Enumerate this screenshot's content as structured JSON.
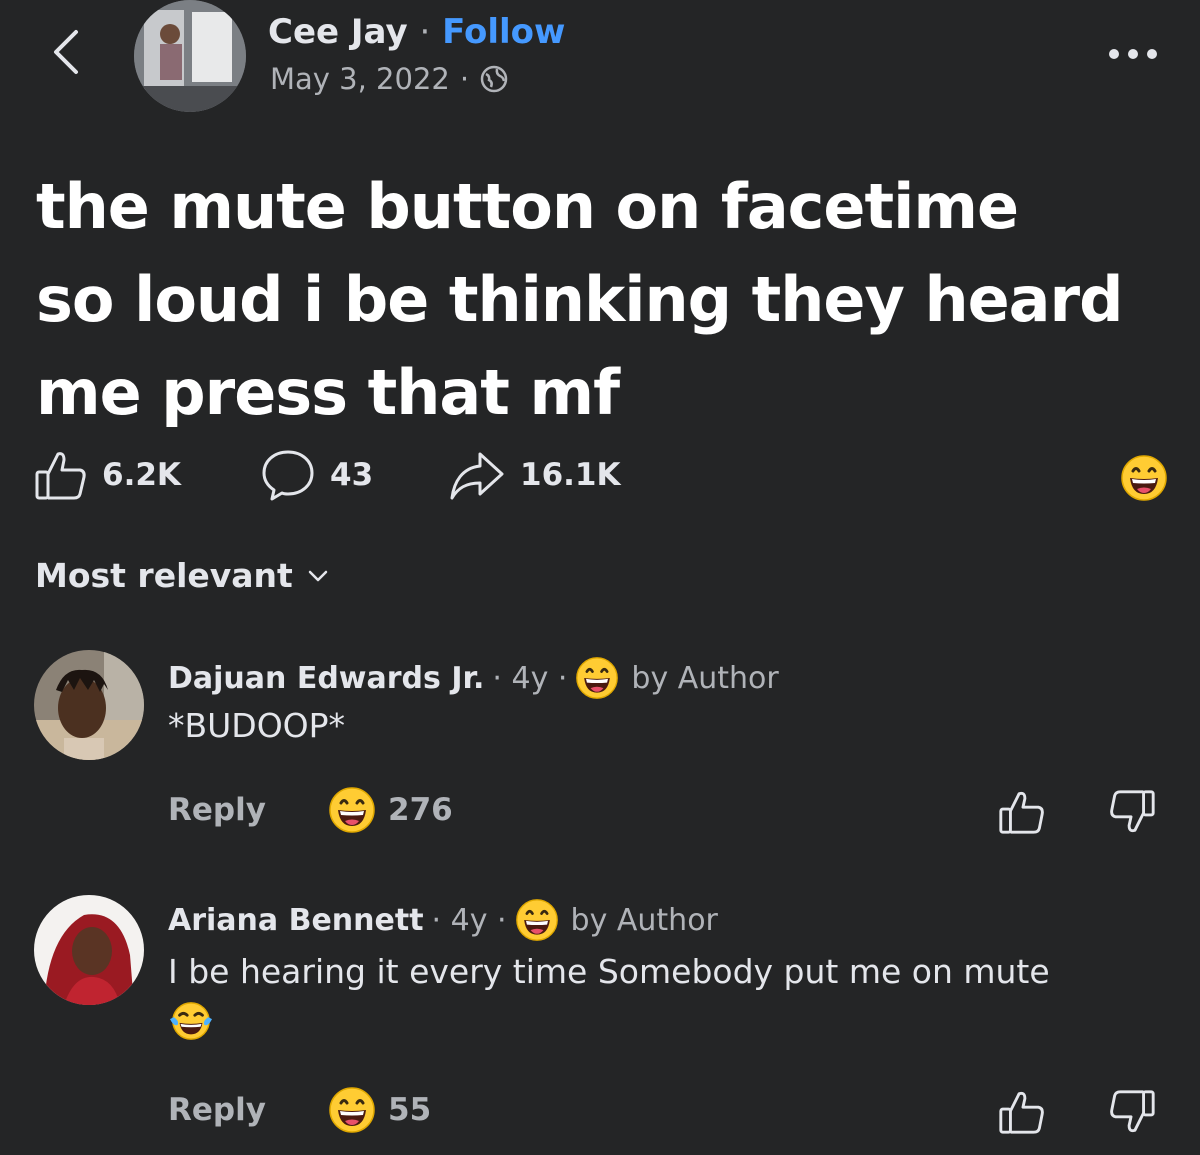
{
  "header": {
    "author_name": "Cee Jay",
    "separator": "·",
    "follow_label": "Follow",
    "date": "May 3, 2022",
    "date_sep": "·",
    "privacy_icon": "globe-icon"
  },
  "post": {
    "lines": [
      "the mute button on facetime",
      "so loud i be thinking they heard",
      "me press that mf"
    ]
  },
  "stats": {
    "likes": "6.2K",
    "comments": "43",
    "shares": "16.1K",
    "reaction_icon": "grin-emoji-icon"
  },
  "sort": {
    "label": "Most relevant"
  },
  "comments": [
    {
      "name": "Dajuan Edwards Jr.",
      "age": "· 4y ·",
      "by_author": "by Author",
      "text": "*BUDOOP*",
      "reply_label": "Reply",
      "reaction_count": "276"
    },
    {
      "name": "Ariana Bennett",
      "age": "· 4y ·",
      "by_author": "by Author",
      "text": "I be hearing it every time Somebody put me on mute",
      "text_emoji": "😂",
      "reply_label": "Reply",
      "reaction_count": "55"
    }
  ],
  "colors": {
    "background": "#242526",
    "text": "#e4e6eb",
    "muted": "#b0b3b8",
    "follow": "#4599ff",
    "emoji_yellow": "#ffcc33"
  }
}
